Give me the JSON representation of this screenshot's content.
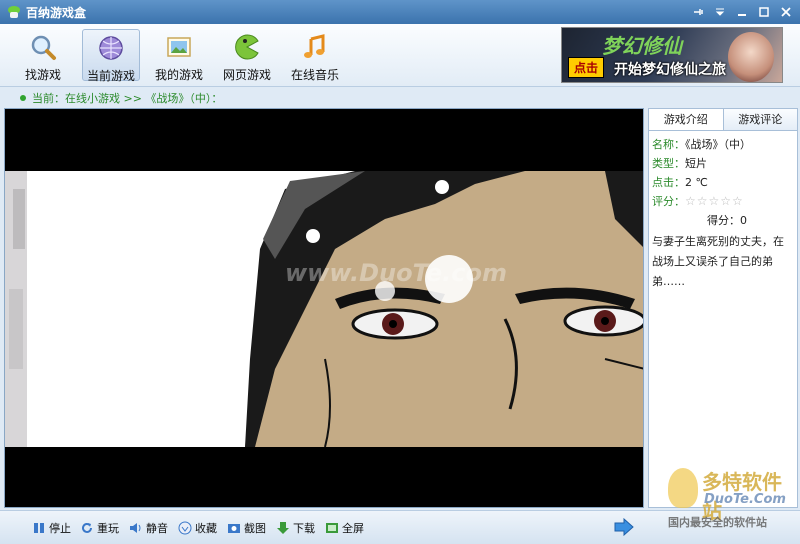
{
  "window": {
    "title": "百纳游戏盒"
  },
  "toolbar": {
    "items": [
      {
        "label": "找游戏",
        "icon": "magnifier-icon"
      },
      {
        "label": "当前游戏",
        "icon": "globe-icon"
      },
      {
        "label": "我的游戏",
        "icon": "picture-icon"
      },
      {
        "label": "网页游戏",
        "icon": "pacman-icon"
      },
      {
        "label": "在线音乐",
        "icon": "music-note-icon"
      }
    ],
    "banner": {
      "title": "梦幻修仙",
      "click_label": "点击",
      "slogan": "开始梦幻修仙之旅"
    }
  },
  "breadcrumb": {
    "text": "当前：在线小游戏 >> 《战场》（中）："
  },
  "game": {
    "watermark": "www.DuoTe.com"
  },
  "panel": {
    "tabs": [
      "游戏介绍",
      "游戏评论"
    ],
    "name_key": "名称：",
    "name_val": "《战场》（中）",
    "type_key": "类型：",
    "type_val": "短片",
    "clicks_key": "点击：",
    "clicks_val": "2 ℃",
    "rating_key": "评分：",
    "rating_stars": "☆☆☆☆☆",
    "rating_value": 0,
    "score_text": "得分：0",
    "description": "与妻子生离死别的丈夫，在战场上又误杀了自己的弟弟……"
  },
  "controls": {
    "stop": "停止",
    "replay": "重玩",
    "mute": "静音",
    "favorite": "收藏",
    "screenshot": "截图",
    "download": "下载",
    "fullscreen": "全屏"
  },
  "site_watermark": {
    "line1": "多特软件站",
    "line2": "DuoTe.Com",
    "line3": "国内最安全的软件站"
  }
}
